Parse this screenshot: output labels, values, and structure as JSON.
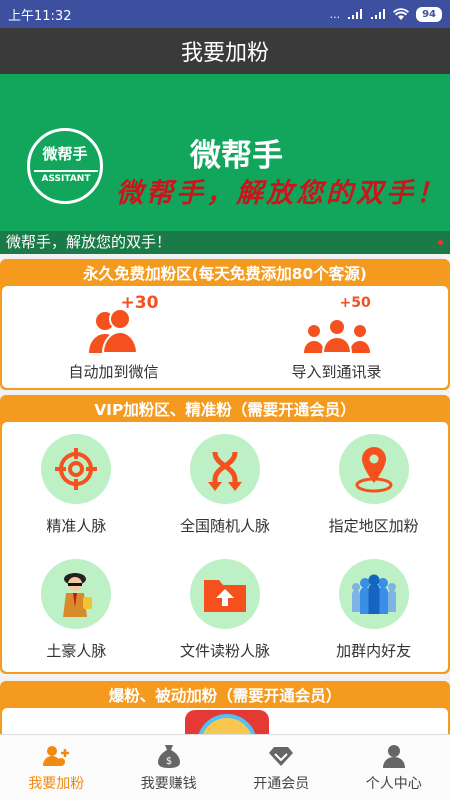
{
  "status_bar": {
    "time": "上午11:32",
    "network": "...",
    "battery": "94"
  },
  "title": "我要加粉",
  "banner": {
    "logo_line1": "微帮手",
    "logo_line2": "ASSITANT",
    "title": "微帮手",
    "slogan": "微帮手，解放您的双手！",
    "caption": "微帮手，解放您的双手！"
  },
  "free_section": {
    "header": "永久免费加粉区(每天免费添加80个客源)",
    "items": [
      {
        "label": "自动加到微信",
        "badge": "+30",
        "icon": "users-plus-icon"
      },
      {
        "label": "导入到通讯录",
        "badge": "+50",
        "icon": "group-plus-icon"
      }
    ]
  },
  "vip_section": {
    "header": "VIP加粉区、精准粉（需要开通会员）",
    "items": [
      {
        "label": "精准人脉",
        "icon": "target-icon"
      },
      {
        "label": "全国随机人脉",
        "icon": "shuffle-icon"
      },
      {
        "label": "指定地区加粉",
        "icon": "location-pin-icon"
      },
      {
        "label": "土豪人脉",
        "icon": "rich-man-icon"
      },
      {
        "label": "文件读粉人脉",
        "icon": "folder-upload-icon"
      },
      {
        "label": "加群内好友",
        "icon": "crowd-icon"
      }
    ]
  },
  "burst_section": {
    "header": "爆粉、被动加粉（需要开通会员）"
  },
  "bottom_nav": [
    {
      "label": "我要加粉",
      "icon": "add-fans-icon",
      "active": true
    },
    {
      "label": "我要赚钱",
      "icon": "money-bag-icon",
      "active": false
    },
    {
      "label": "开通会员",
      "icon": "diamond-icon",
      "active": false
    },
    {
      "label": "个人中心",
      "icon": "person-icon",
      "active": false
    }
  ],
  "colors": {
    "accent": "#f08a10",
    "section_bg": "#f39a1f",
    "banner_bg": "#12a65c",
    "title_bg": "#3a3a3a",
    "status_bg": "#3d4f9f",
    "icon_orange": "#f4511e",
    "icon_circle": "#bdf0c4"
  }
}
